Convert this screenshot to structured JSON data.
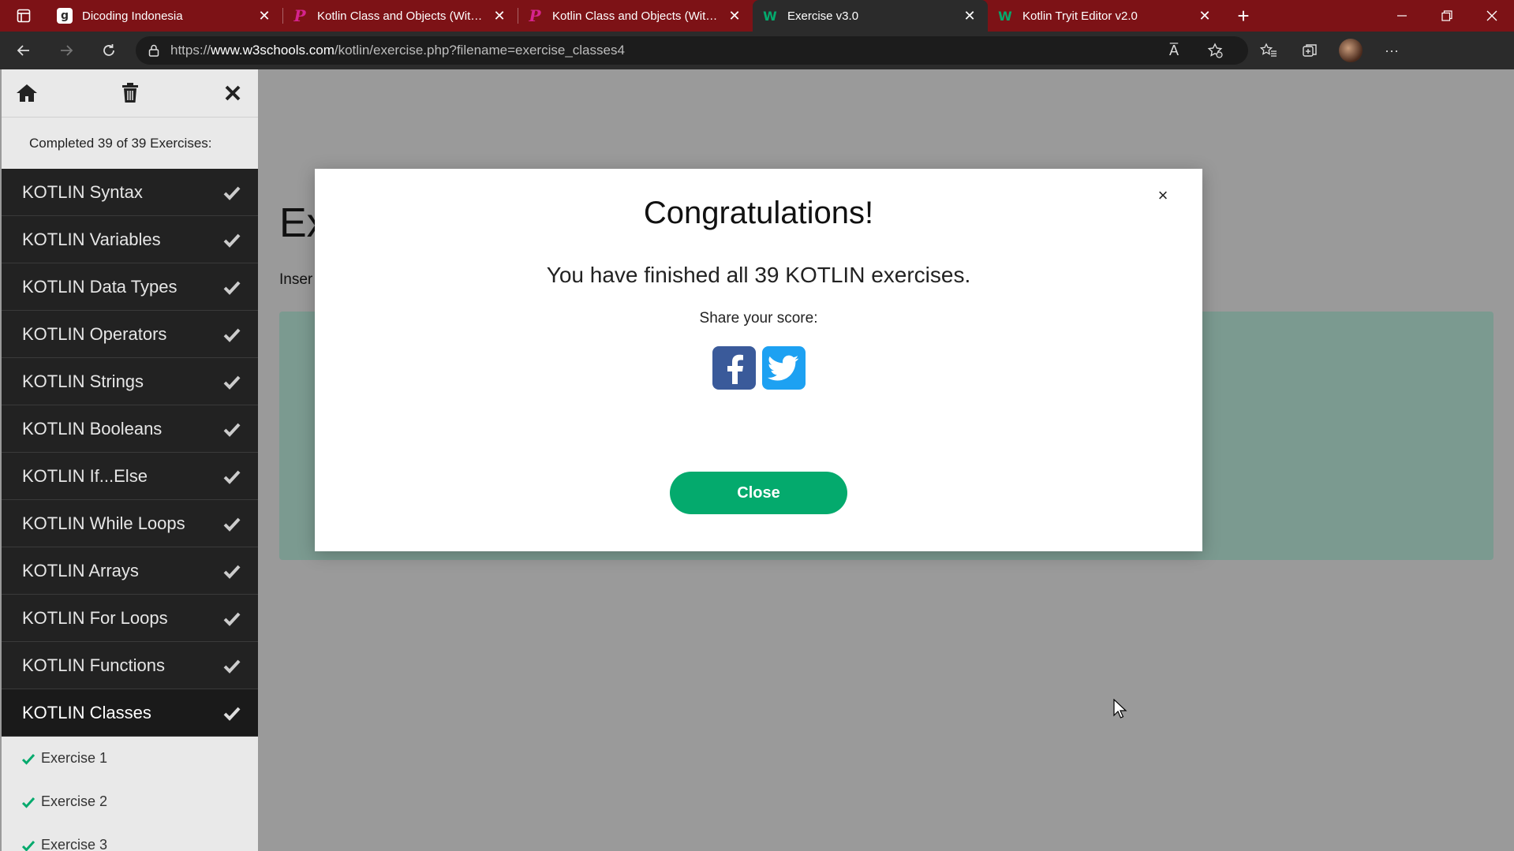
{
  "browser": {
    "tabs": [
      {
        "favicon": "g",
        "title": "Dicoding Indonesia",
        "active": false
      },
      {
        "favicon": "p",
        "title": "Kotlin Class and Objects (With Ex",
        "active": false
      },
      {
        "favicon": "p",
        "title": "Kotlin Class and Objects (With Ex",
        "active": false
      },
      {
        "favicon": "w",
        "title": "Exercise v3.0",
        "active": true
      },
      {
        "favicon": "w",
        "title": "Kotlin Tryit Editor v2.0",
        "active": false
      }
    ],
    "url": {
      "prefix": "https://",
      "host": "www.w3schools.com",
      "path": "/kotlin/exercise.php?filename=exercise_classes4"
    },
    "read_aloud_label": "A̅"
  },
  "sidebar": {
    "status": "Completed 39 of 39 Exercises:",
    "categories": [
      "KOTLIN Syntax",
      "KOTLIN Variables",
      "KOTLIN Data Types",
      "KOTLIN Operators",
      "KOTLIN Strings",
      "KOTLIN Booleans",
      "KOTLIN If...Else",
      "KOTLIN While Loops",
      "KOTLIN Arrays",
      "KOTLIN For Loops",
      "KOTLIN Functions",
      "KOTLIN Classes"
    ],
    "exercises": [
      "Exercise 1",
      "Exercise 2",
      "Exercise 3"
    ]
  },
  "main": {
    "heading": "Ex",
    "instruction": "Inser"
  },
  "modal": {
    "title": "Congratulations!",
    "message": "You have finished all 39 KOTLIN exercises.",
    "share_label": "Share your score:",
    "close_label": "Close",
    "close_symbol": "×"
  },
  "colors": {
    "tabstrip": "#7d1216",
    "accent_green": "#04aa6d",
    "facebook": "#3a5a9a",
    "twitter": "#1da1f2"
  }
}
